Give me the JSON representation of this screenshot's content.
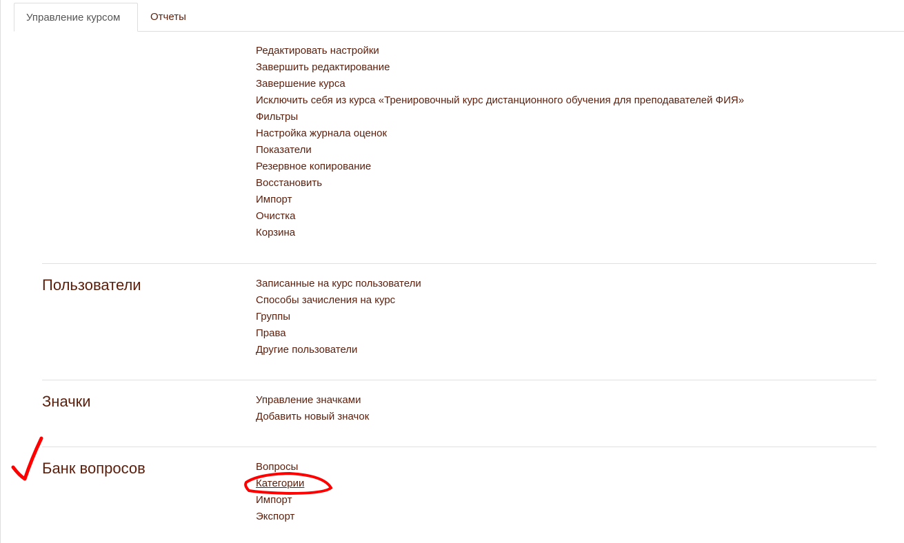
{
  "tabs": [
    {
      "label": "Управление курсом",
      "active": true
    },
    {
      "label": "Отчеты",
      "active": false
    }
  ],
  "sections": [
    {
      "heading": "",
      "links": [
        "Редактировать настройки",
        "Завершить редактирование",
        "Завершение курса",
        "Исключить себя из курса «Тренировочный курс дистанционного обучения для преподавателей ФИЯ»",
        "Фильтры",
        "Настройка журнала оценок",
        "Показатели",
        "Резервное копирование",
        "Восстановить",
        "Импорт",
        "Очистка",
        "Корзина"
      ]
    },
    {
      "heading": "Пользователи",
      "links": [
        "Записанные на курс пользователи",
        "Способы зачисления на курс",
        "Группы",
        "Права",
        "Другие пользователи"
      ]
    },
    {
      "heading": "Значки",
      "links": [
        "Управление значками",
        "Добавить новый значок"
      ]
    },
    {
      "heading": "Банк вопросов",
      "links": [
        "Вопросы",
        "Категории",
        "Импорт",
        "Экспорт"
      ]
    }
  ],
  "annotation_color": "#ff0000",
  "text_color": "#5b1e0b"
}
